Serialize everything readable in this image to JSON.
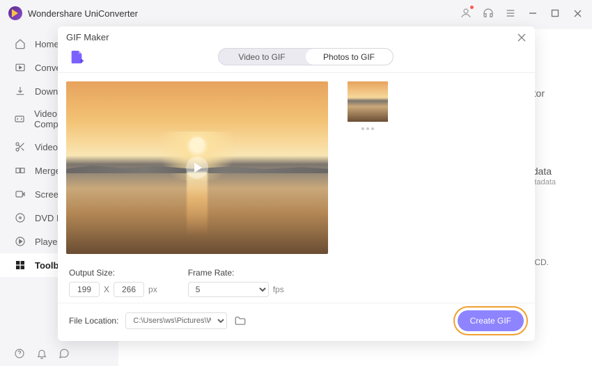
{
  "app": {
    "title": "Wondershare UniConverter"
  },
  "titlebar_icons": {
    "minimize": "—",
    "maximize": "☐",
    "close": "✕"
  },
  "sidebar": {
    "items": [
      {
        "label": "Home"
      },
      {
        "label": "Converter"
      },
      {
        "label": "Downloader"
      },
      {
        "label": "Video Compressor"
      },
      {
        "label": "Video Editor"
      },
      {
        "label": "Merger"
      },
      {
        "label": "Screen Recorder"
      },
      {
        "label": "DVD Burner"
      },
      {
        "label": "Player"
      },
      {
        "label": "Toolbox"
      }
    ]
  },
  "modal": {
    "title": "GIF Maker",
    "tabs": {
      "first": "Video to GIF",
      "second": "Photos to GIF"
    },
    "output_size_label": "Output Size:",
    "output_w": "199",
    "output_h": "266",
    "size_sep": "X",
    "px_unit": "px",
    "framerate_label": "Frame Rate:",
    "framerate_value": "5",
    "fps_unit": "fps",
    "file_location_label": "File Location:",
    "file_location_value": "C:\\Users\\ws\\Pictures\\Wonders",
    "create_button": "Create GIF"
  },
  "background_cards": {
    "c1": "tor",
    "c2": "data",
    "c3": "etadata",
    "c4": "CD."
  }
}
